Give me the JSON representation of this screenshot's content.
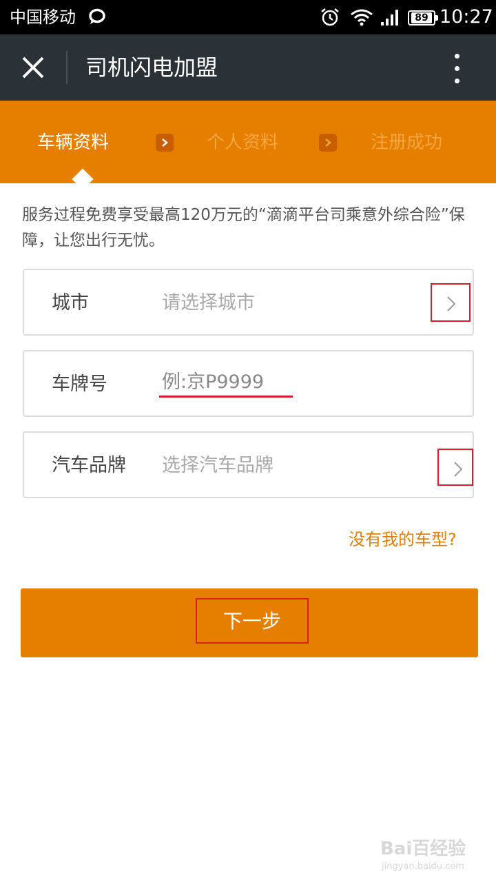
{
  "status_bar": {
    "carrier": "中国移动",
    "battery": "89",
    "time": "10:27"
  },
  "title_bar": {
    "title": "司机闪电加盟"
  },
  "steps": {
    "items": [
      "车辆资料",
      "个人资料",
      "注册成功"
    ],
    "active_index": 0
  },
  "notice": "服务过程免费享受最高120万元的“滴滴平台司乘意外综合险”保障，让您出行无忧。",
  "form": {
    "city": {
      "label": "城市",
      "placeholder": "请选择城市"
    },
    "plate": {
      "label": "车牌号",
      "placeholder": "例:京P9999"
    },
    "brand": {
      "label": "汽车品牌",
      "placeholder": "选择汽车品牌"
    }
  },
  "no_model_link": "没有我的车型?",
  "next_button": "下一步",
  "watermark": {
    "main": "Bai百经验",
    "sub": "jingyan.baidu.com"
  },
  "colors": {
    "accent": "#e67e00",
    "title_bar": "#2b3237",
    "highlight": "#d81e28"
  }
}
